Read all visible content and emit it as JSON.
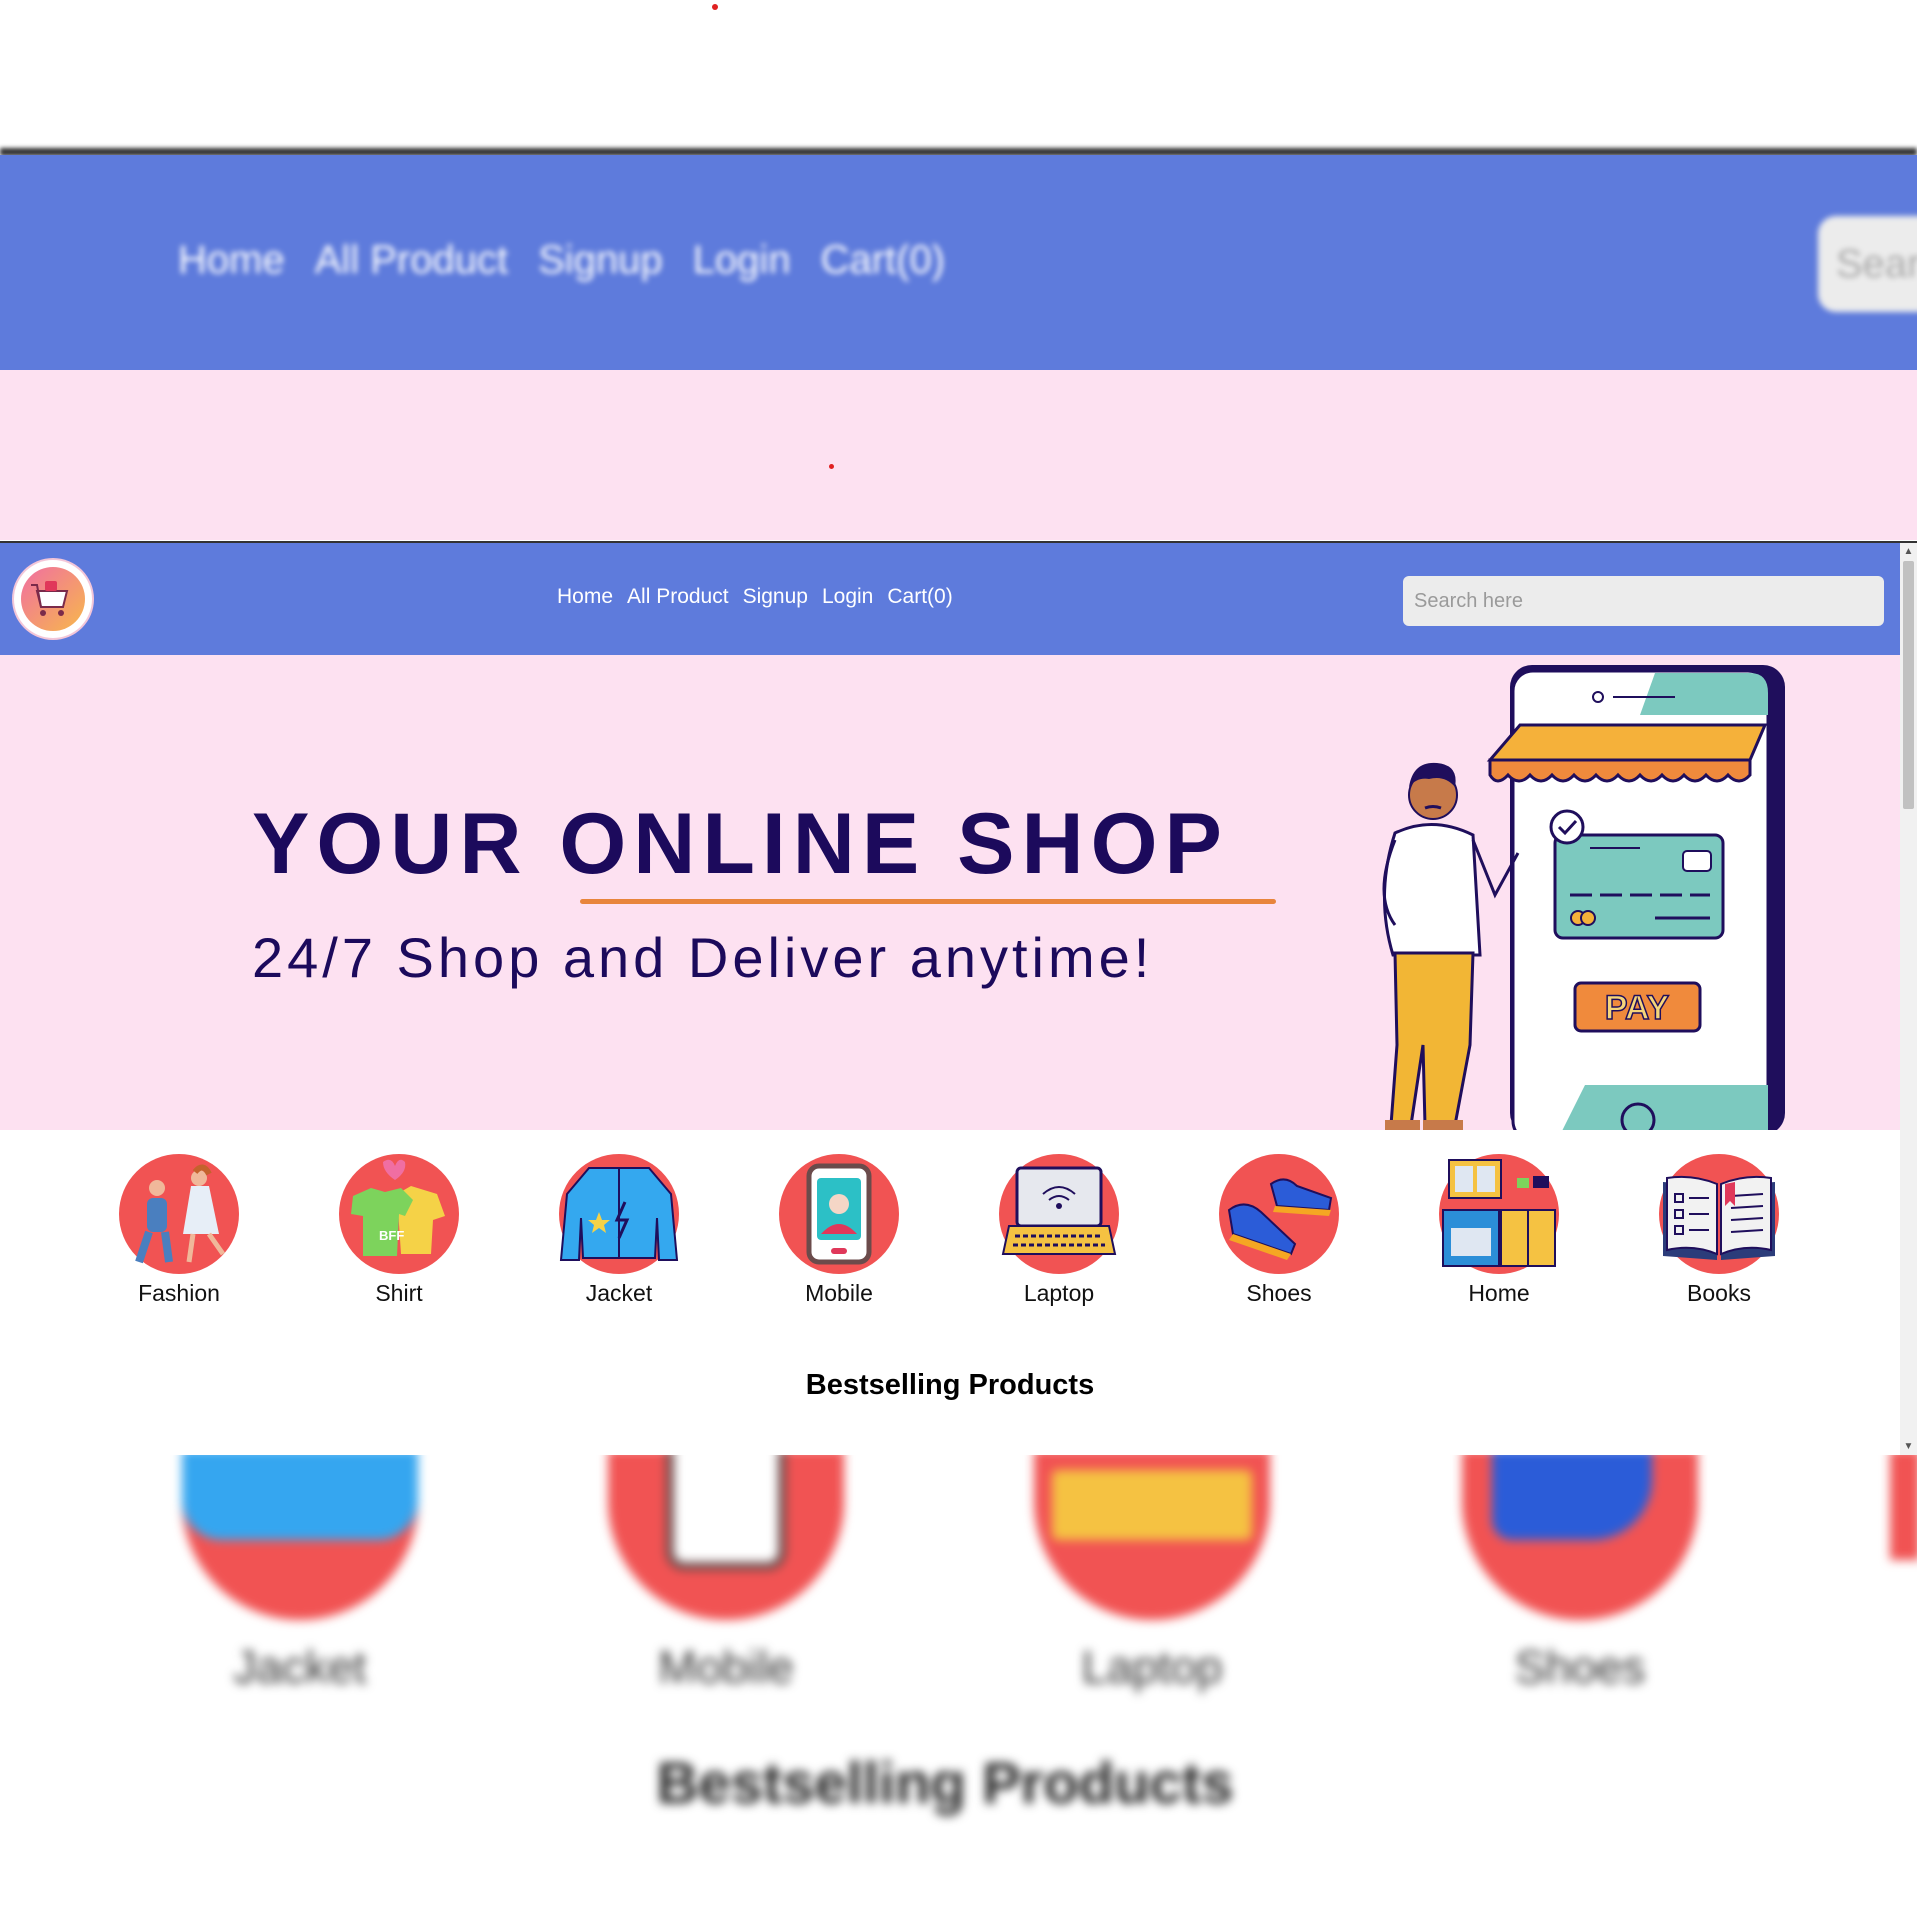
{
  "nav": {
    "links": [
      "Home",
      "All Product",
      "Signup",
      "Login",
      "Cart(0)"
    ],
    "search_placeholder": "Search here",
    "blurred_search_text": "Sear"
  },
  "hero": {
    "title": "YOUR ONLINE SHOP",
    "subtitle": "24/7 Shop and Deliver anytime!",
    "pay_label": "PAY"
  },
  "categories": [
    "Fashion",
    "Shirt",
    "Jacket",
    "Mobile",
    "Laptop",
    "Shoes",
    "Home",
    "Books"
  ],
  "section_title": "Bestselling Products",
  "background": {
    "bottom_labels": [
      "Jacket",
      "Mobile",
      "Laptop",
      "Shoes"
    ],
    "bottom_title": "Bestselling Products"
  },
  "colors": {
    "navbar": "#5e7bdc",
    "hero_bg": "#fde1f1",
    "title_text": "#1c0a5c",
    "underline": "#e8853c",
    "category_circle": "#f15353"
  }
}
